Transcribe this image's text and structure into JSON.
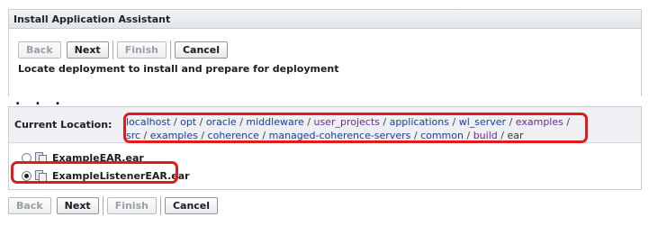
{
  "dialog": {
    "title": "Install Application Assistant"
  },
  "buttons": {
    "back": "Back",
    "next": "Next",
    "finish": "Finish",
    "cancel": "Cancel"
  },
  "description": "Locate deployment to install and prepare for deployment",
  "ellipsis": ". . .",
  "location": {
    "label": "Current Location:",
    "segments": [
      {
        "text": "localhost",
        "visited": false
      },
      {
        "text": "opt",
        "visited": false
      },
      {
        "text": "oracle",
        "visited": false
      },
      {
        "text": "middleware",
        "visited": false
      },
      {
        "text": "user_projects",
        "visited": true
      },
      {
        "text": "applications",
        "visited": false
      },
      {
        "text": "wl_server",
        "visited": false
      },
      {
        "text": "examples",
        "visited": true
      },
      {
        "text": "src",
        "visited": false
      },
      {
        "text": "examples",
        "visited": false
      },
      {
        "text": "coherence",
        "visited": false
      },
      {
        "text": "managed-coherence-servers",
        "visited": false
      },
      {
        "text": "common",
        "visited": false
      },
      {
        "text": "build",
        "visited": true
      },
      {
        "text": "ear",
        "visited": false,
        "current": true
      }
    ],
    "separator": "/"
  },
  "files": [
    {
      "name": "ExampleEAR.ear",
      "selected": false
    },
    {
      "name": "ExampleListenerEAR.ear",
      "selected": true
    }
  ],
  "colors": {
    "highlight": "#e01b1b",
    "link": "#1c3f94",
    "visited": "#6e2b8c"
  }
}
